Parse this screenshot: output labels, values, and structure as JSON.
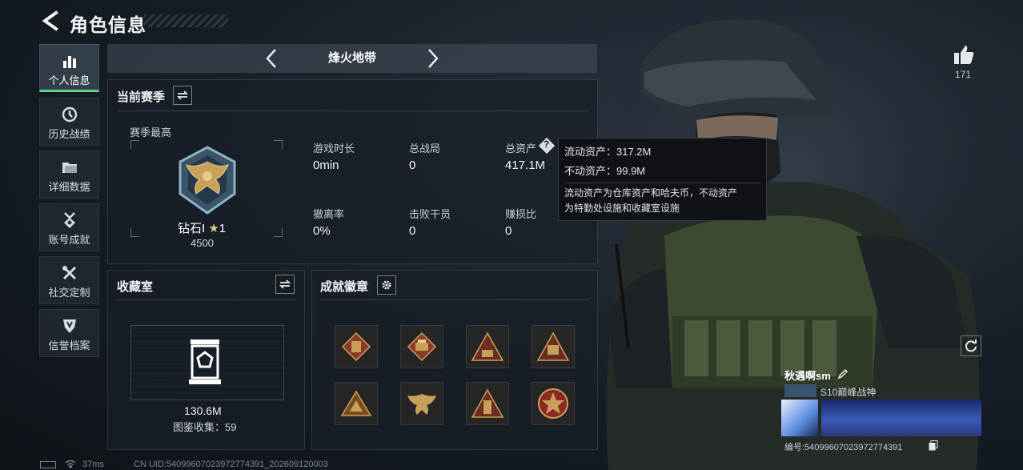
{
  "header": {
    "title": "角色信息"
  },
  "sidebar": {
    "items": [
      {
        "label": "个人信息",
        "icon": "bar-chart-icon",
        "active": true
      },
      {
        "label": "历史战绩",
        "icon": "history-icon"
      },
      {
        "label": "详细数据",
        "icon": "folder-icon"
      },
      {
        "label": "账号成就",
        "icon": "medal-icon"
      },
      {
        "label": "社交定制",
        "icon": "tools-icon"
      },
      {
        "label": "信誉档案",
        "icon": "shield-icon"
      }
    ]
  },
  "map": {
    "name": "烽火地带"
  },
  "season": {
    "title": "当前赛季",
    "highest_label": "赛季最高",
    "rank_name": "钻石I",
    "rank_stars": "1",
    "rank_points": "4500",
    "stats": [
      {
        "label": "游戏时长",
        "value": "0min"
      },
      {
        "label": "总战局",
        "value": "0"
      },
      {
        "label": "总资产",
        "value": "417.1M"
      },
      {
        "label": "撤离率",
        "value": "0%"
      },
      {
        "label": "击败干员",
        "value": "0"
      },
      {
        "label": "赚损比",
        "value": "0"
      }
    ]
  },
  "tooltip": {
    "liquid": "流动资产：317.2M",
    "fixed": "不动资产：99.9M",
    "note1": "流动资产为仓库资产和哈夫币，不动资产",
    "note2": "为特勤处设施和收藏室设施"
  },
  "collection": {
    "title": "收藏室",
    "value": "130.6M",
    "count_label": "图鉴收集：59"
  },
  "achievements": {
    "title": "成就徽章",
    "badges": [
      "vest-badge-icon",
      "printer-badge-icon",
      "56-triangle-badge-icon",
      "car-badge-icon",
      "tent-badge-icon",
      "eagle-badge-icon",
      "tower-badge-icon",
      "star-cross-badge-icon"
    ]
  },
  "likes": {
    "count": "171"
  },
  "profile": {
    "name": "秋遇啊sm",
    "title": "S10巅峰战神",
    "uid_label": "编号:540996070239727743​91"
  },
  "status_bar": {
    "ping": "37ms",
    "uid_text": "CN UID:540996070239727743​91_202609120003"
  },
  "colors": {
    "accent_green": "#5fd58a",
    "tooltip_bg": "#0e1115",
    "badge_gold": "#c9a05a"
  }
}
